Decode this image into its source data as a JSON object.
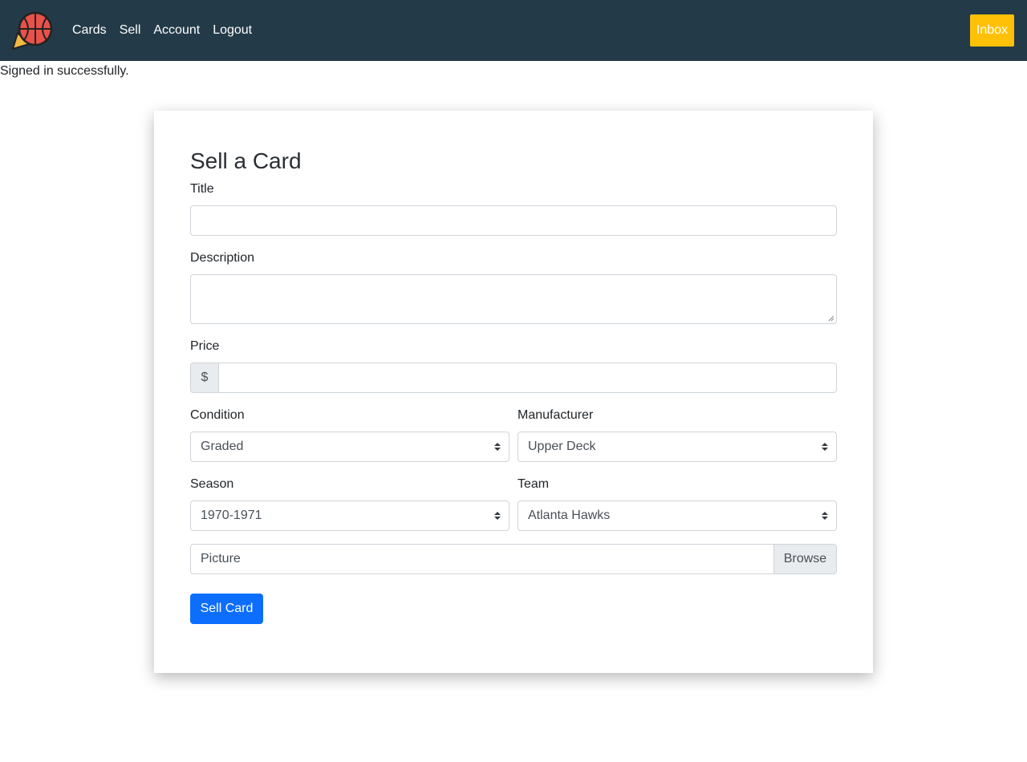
{
  "navbar": {
    "logo_icon": "basketball-logo-icon",
    "links": [
      "Cards",
      "Sell",
      "Account",
      "Logout"
    ],
    "inbox_label": "Inbox",
    "colors": {
      "background": "#233a48",
      "inbox": "#ffc107"
    }
  },
  "flash": {
    "message": "Signed in successfully."
  },
  "form": {
    "heading": "Sell a Card",
    "title_label": "Title",
    "title_value": "",
    "description_label": "Description",
    "description_value": "",
    "price_label": "Price",
    "price_prefix": "$",
    "price_value": "",
    "condition_label": "Condition",
    "condition_selected": "Graded",
    "manufacturer_label": "Manufacturer",
    "manufacturer_selected": "Upper Deck",
    "season_label": "Season",
    "season_selected": "1970-1971",
    "team_label": "Team",
    "team_selected": "Atlanta Hawks",
    "picture_label": "Picture",
    "browse_label": "Browse",
    "submit_label": "Sell Card",
    "submit_color": "#0d6efd"
  }
}
